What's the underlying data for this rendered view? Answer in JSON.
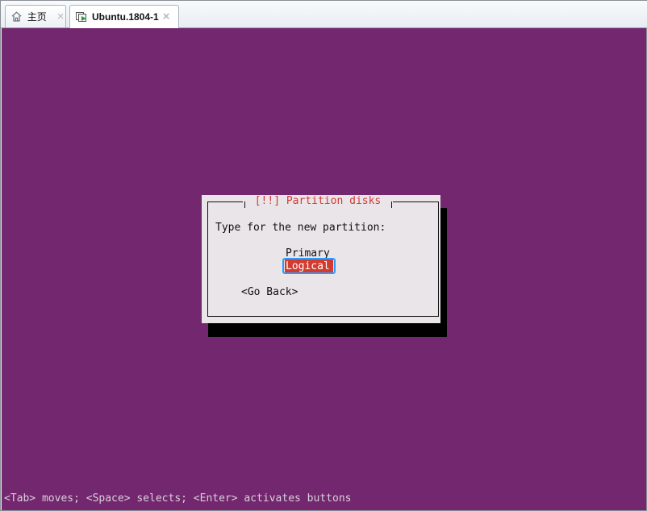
{
  "tabs": [
    {
      "label": "主页",
      "icon": "home-icon",
      "close": "×"
    },
    {
      "label": "Ubuntu.1804-1",
      "icon": "virtual-machine-icon",
      "close": "×"
    }
  ],
  "dialog": {
    "title": "[!!] Partition disks",
    "prompt": "Type for the new partition:",
    "options": [
      "Primary",
      "Logical"
    ],
    "selected": "Logical",
    "back_button": "<Go Back>"
  },
  "status_bar": {
    "text": "<Tab> moves; <Space> selects; <Enter> activates buttons"
  },
  "colors": {
    "console_background": "#73276f",
    "dialog_background": "#e9e5e8",
    "title_text": "#d33a35",
    "selection_background": "#d23b2e",
    "focus_outline": "#2b9cff"
  }
}
